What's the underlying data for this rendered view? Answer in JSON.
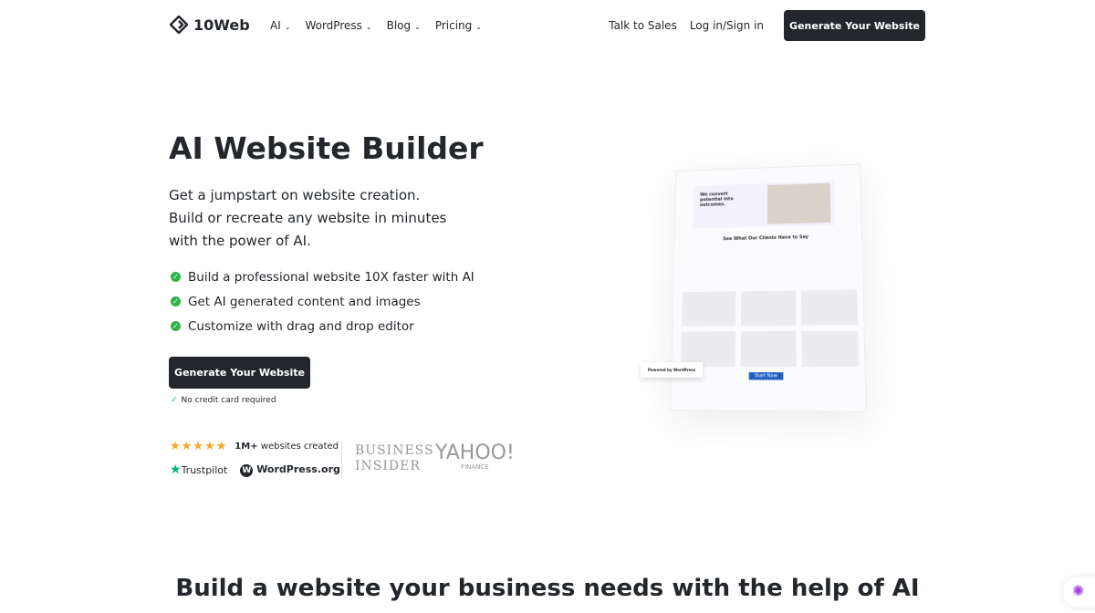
{
  "nav": {
    "logo": "10Web",
    "menu": [
      {
        "label": "AI"
      },
      {
        "label": "WordPress"
      },
      {
        "label": "Blog"
      },
      {
        "label": "Pricing"
      }
    ],
    "talk": "Talk to Sales",
    "login": "Log in/Sign in",
    "cta": "Generate Your Website"
  },
  "hero": {
    "title": "AI Website Builder",
    "sub": [
      "Get a jumpstart on website creation.",
      "Build or recreate any website in minutes",
      "with the power of AI."
    ],
    "features": [
      "Build a professional website 10X faster with AI",
      "Get AI generated content and images",
      "Customize with drag and drop editor"
    ],
    "cta": "Generate Your Website",
    "note": "No credit card required"
  },
  "trust": {
    "count": "1M+",
    "count_label": "websites created",
    "trustpilot": "Trustpilot",
    "wordpress": "WordPress.org",
    "bi1": "BUSINESS",
    "bi2": "INSIDER",
    "yahoo": "YAHOO!",
    "finance": "FINANCE"
  },
  "mock": {
    "headline": "We convert potential into outcomes.",
    "clients": "See What Our Clients Have to Say",
    "start": "Start Now",
    "powered": "Powered by WordPress"
  },
  "section": {
    "title": "Build a website your business needs with the help of AI"
  },
  "colors": {
    "accent": "#23272b",
    "check": "#2fb34a",
    "star": "#f5a623"
  }
}
